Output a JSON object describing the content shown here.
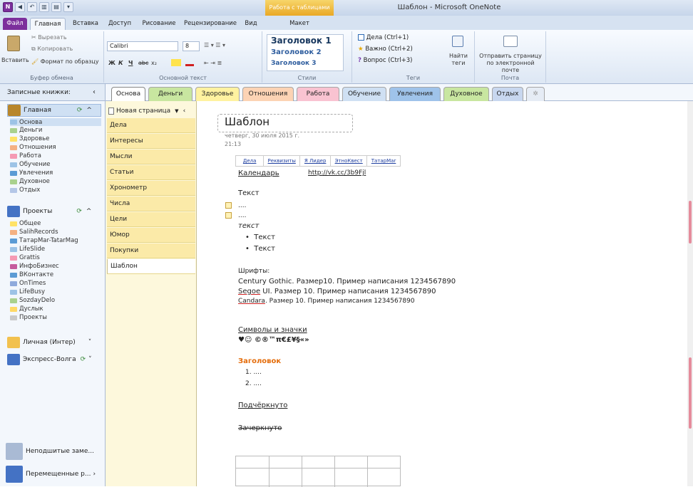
{
  "window": {
    "title": "Шаблон - Microsoft OneNote",
    "context_tab": "Работа с таблицами"
  },
  "ribbon_tabs": [
    {
      "label": "Файл"
    },
    {
      "label": "Главная"
    },
    {
      "label": "Вставка"
    },
    {
      "label": "Доступ"
    },
    {
      "label": "Рисование"
    },
    {
      "label": "Рецензирование"
    },
    {
      "label": "Вид"
    },
    {
      "label": "Макет"
    }
  ],
  "clipboard": {
    "paste": "Вставить",
    "cut": "Вырезать",
    "copy": "Копировать",
    "format_painter": "Формат по образцу",
    "label": "Буфер обмена"
  },
  "font": {
    "name": "Calibri",
    "size": "8",
    "label": "Основной текст",
    "bold": "Ж",
    "italic": "К",
    "underline": "Ч",
    "strike": "abc",
    "subscript": "x₂"
  },
  "styles": {
    "items": [
      "Заголовок 1",
      "Заголовок 2",
      "Заголовок 3"
    ],
    "label": "Стили"
  },
  "tags": {
    "items": [
      "Дела (Ctrl+1)",
      "Важно (Ctrl+2)",
      "Вопрос (Ctrl+3)"
    ],
    "find": "Найти теги",
    "label": "Теги"
  },
  "mail": {
    "send": "Отправить страницу по электронной почте",
    "label": "Почта"
  },
  "notebooks_header": "Записные книжки:",
  "notebooks": [
    {
      "name": "Главная",
      "color": "#b8862b",
      "sections": [
        {
          "name": "Основа",
          "color": "#9dc3e6",
          "selected": true
        },
        {
          "name": "Деньги",
          "color": "#a9d18e"
        },
        {
          "name": "Здоровье",
          "color": "#ffe266"
        },
        {
          "name": "Отношения",
          "color": "#f4b183"
        },
        {
          "name": "Работа",
          "color": "#f59ab4"
        },
        {
          "name": "Обучение",
          "color": "#9dc3e6"
        },
        {
          "name": "Увлечения",
          "color": "#5b9bd5"
        },
        {
          "name": "Духовное",
          "color": "#a9d18e"
        },
        {
          "name": "Отдых",
          "color": "#b4c7e7"
        }
      ]
    },
    {
      "name": "Проекты",
      "color": "#4472c4",
      "sections": [
        {
          "name": "Общее",
          "color": "#ffe266"
        },
        {
          "name": "SalihRecords",
          "color": "#f4b183"
        },
        {
          "name": "ТатарMar-TatarMag",
          "color": "#5b9bd5"
        },
        {
          "name": "LifeSlide",
          "color": "#9dc3e6"
        },
        {
          "name": "Grattis",
          "color": "#f59ab4"
        },
        {
          "name": "ИнфоБизнес",
          "color": "#c55a9d"
        },
        {
          "name": "ВКонтакте",
          "color": "#5b9bd5"
        },
        {
          "name": "OnTimes",
          "color": "#8faadc"
        },
        {
          "name": "LifeBusy",
          "color": "#9dc3e6"
        },
        {
          "name": "SozdayDelo",
          "color": "#a9d18e"
        },
        {
          "name": "Дуслык",
          "color": "#ffd966"
        },
        {
          "name": "Проекты",
          "color": "#c9c9c9"
        }
      ]
    },
    {
      "name": "Личная (Интер)",
      "color": "#f2c14e"
    },
    {
      "name": "Экспресс-Волга",
      "color": "#4472c4"
    }
  ],
  "bottom_nav": [
    "Неподшитые заме...",
    "Перемещенные р..."
  ],
  "section_tabs": [
    {
      "name": "Основа",
      "color": "#ffffff"
    },
    {
      "name": "Деньги",
      "color": "#c8e6a0"
    },
    {
      "name": "Здоровье",
      "color": "#fff2a0"
    },
    {
      "name": "Отношения",
      "color": "#fcd3b4"
    },
    {
      "name": "Работа",
      "color": "#f9c3d1"
    },
    {
      "name": "Обучение",
      "color": "#cfe0f3"
    },
    {
      "name": "Увлечения",
      "color": "#9fc3ea"
    },
    {
      "name": "Духовное",
      "color": "#c8e6a0"
    },
    {
      "name": "Отдых",
      "color": "#c8d7ef"
    },
    {
      "name": "✲",
      "color": "#e6ecf5"
    }
  ],
  "new_page": "Новая страница",
  "pages": [
    "Дела",
    "Интересы",
    "Мысли",
    "Статьи",
    "Хронометр",
    "Числа",
    "Цели",
    "Юмор",
    "Покупки",
    "Шаблон"
  ],
  "page": {
    "title": "Шаблон",
    "date": "четверг, 30 июля 2015 г.",
    "time": "21:13",
    "small_links": [
      "Дела",
      "Реквизиты",
      "Я Лидер",
      "ЭтноКвест",
      "ТатарMar"
    ],
    "calendar_link": "Календарь",
    "url_link": "http://vk.cc/3b9Fjl",
    "text_heading": "Текст",
    "todo1": "....",
    "todo2": "....",
    "italic_text": "текст",
    "bullet1": "Текст",
    "bullet2": "Текст",
    "fonts_label": "Шрифты:",
    "font_line1": "Century Gothic. Размер10. Пример написания 1234567890",
    "font_line2_name": "Segoe",
    "font_line2_rest": " UI. Размер 10. Пример написания 1234567890",
    "font_line3_name": "Candara",
    "font_line3_rest": ". Размер 10. Пример написания 1234567890",
    "symbols_link": "Символы и значки",
    "symbols": "♥☺ ©®™π€£¥§«»",
    "heading": "Заголовок",
    "num1": "1.  ....",
    "num2": "2.  ....",
    "underlined": "Подчёркнуто",
    "strikethrough": "Зачеркнуто"
  }
}
